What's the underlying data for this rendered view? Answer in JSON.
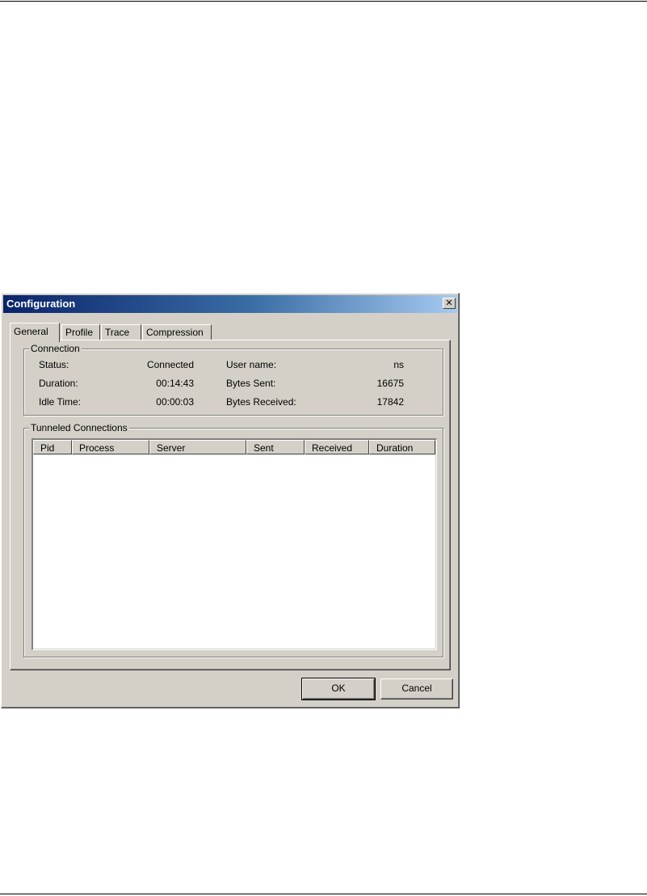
{
  "window": {
    "title": "Configuration",
    "close_glyph": "✕"
  },
  "tabs": [
    {
      "label": "General",
      "active": true
    },
    {
      "label": "Profile",
      "active": false
    },
    {
      "label": "Trace",
      "active": false
    },
    {
      "label": "Compression",
      "active": false
    }
  ],
  "connection": {
    "legend": "Connection",
    "status_label": "Status:",
    "status_value": "Connected",
    "duration_label": "Duration:",
    "duration_value": "00:14:43",
    "idle_label": "Idle Time:",
    "idle_value": "00:00:03",
    "user_label": "User name:",
    "user_value": "ns",
    "sent_label": "Bytes Sent:",
    "sent_value": "16675",
    "received_label": "Bytes Received:",
    "received_value": "17842"
  },
  "tunnels": {
    "legend": "Tunneled Connections",
    "columns": [
      "Pid",
      "Process",
      "Server",
      "Sent",
      "Received",
      "Duration"
    ],
    "rows": []
  },
  "buttons": {
    "ok": "OK",
    "cancel": "Cancel"
  }
}
